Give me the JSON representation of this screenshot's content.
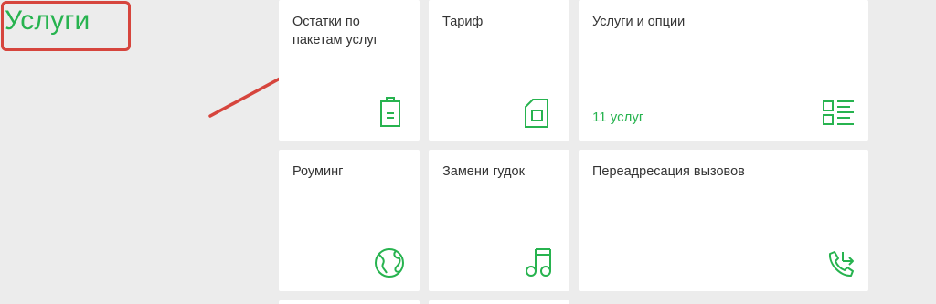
{
  "page": {
    "title": "Услуги"
  },
  "tiles": [
    {
      "label": "Остатки по пакетам услуг",
      "icon": "battery-icon"
    },
    {
      "label": "Тариф",
      "icon": "sim-card-icon"
    },
    {
      "label": "Услуги и опции",
      "count": "11 услуг",
      "icon": "services-list-icon"
    },
    {
      "label": "Роуминг",
      "icon": "globe-icon"
    },
    {
      "label": "Замени гудок",
      "icon": "music-note-icon"
    },
    {
      "label": "Переадресация вызовов",
      "icon": "call-forward-icon"
    }
  ],
  "colors": {
    "accent": "#27b34f",
    "annotation": "#d6453d",
    "background": "#ececec",
    "tile": "#ffffff"
  }
}
